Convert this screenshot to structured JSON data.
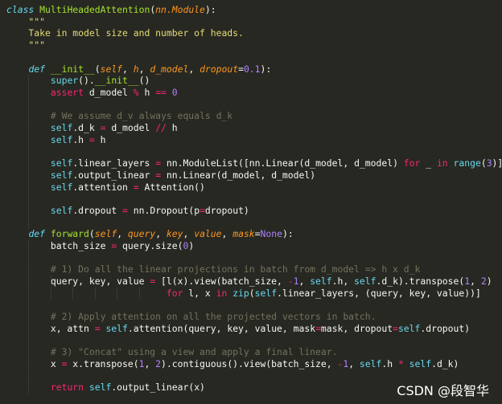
{
  "code_lines": [
    {
      "parts": [
        {
          "t": "class",
          "c": "kw"
        },
        {
          "t": " "
        },
        {
          "t": "MultiHeadedAttention",
          "c": "cls"
        },
        {
          "t": "("
        },
        {
          "t": "nn.Module",
          "c": "param"
        },
        {
          "t": "):"
        }
      ]
    },
    {
      "parts": [
        {
          "t": "    \"\"\"",
          "c": "str"
        }
      ]
    },
    {
      "parts": [
        {
          "t": "    Take in model size and number of heads.",
          "c": "str"
        }
      ]
    },
    {
      "parts": [
        {
          "t": "    \"\"\"",
          "c": "str"
        }
      ]
    },
    {
      "parts": []
    },
    {
      "parts": [
        {
          "t": "    "
        },
        {
          "t": "def",
          "c": "kw"
        },
        {
          "t": " "
        },
        {
          "t": "__init__",
          "c": "fn"
        },
        {
          "t": "("
        },
        {
          "t": "self",
          "c": "param"
        },
        {
          "t": ", "
        },
        {
          "t": "h",
          "c": "param"
        },
        {
          "t": ", "
        },
        {
          "t": "d_model",
          "c": "param"
        },
        {
          "t": ", "
        },
        {
          "t": "dropout",
          "c": "param"
        },
        {
          "t": "="
        },
        {
          "t": "0.1",
          "c": "num"
        },
        {
          "t": "):"
        }
      ]
    },
    {
      "parts": [
        {
          "t": "        "
        },
        {
          "t": "super",
          "c": "bi"
        },
        {
          "t": "()."
        },
        {
          "t": "__init__",
          "c": "fn"
        },
        {
          "t": "()"
        }
      ]
    },
    {
      "parts": [
        {
          "t": "        "
        },
        {
          "t": "assert",
          "c": "kwp"
        },
        {
          "t": " d_model "
        },
        {
          "t": "%",
          "c": "op"
        },
        {
          "t": " h "
        },
        {
          "t": "==",
          "c": "op"
        },
        {
          "t": " "
        },
        {
          "t": "0",
          "c": "num"
        }
      ]
    },
    {
      "parts": []
    },
    {
      "parts": [
        {
          "t": "        # We assume d_v always equals d_k",
          "c": "cmt"
        }
      ]
    },
    {
      "parts": [
        {
          "t": "        "
        },
        {
          "t": "self",
          "c": "self"
        },
        {
          "t": ".d_k "
        },
        {
          "t": "=",
          "c": "op"
        },
        {
          "t": " d_model "
        },
        {
          "t": "//",
          "c": "op"
        },
        {
          "t": " h"
        }
      ]
    },
    {
      "parts": [
        {
          "t": "        "
        },
        {
          "t": "self",
          "c": "self"
        },
        {
          "t": ".h "
        },
        {
          "t": "=",
          "c": "op"
        },
        {
          "t": " h"
        }
      ]
    },
    {
      "parts": []
    },
    {
      "parts": [
        {
          "t": "        "
        },
        {
          "t": "self",
          "c": "self"
        },
        {
          "t": ".linear_layers "
        },
        {
          "t": "=",
          "c": "op"
        },
        {
          "t": " nn.ModuleList([nn.Linear(d_model, d_model) "
        },
        {
          "t": "for",
          "c": "kwp"
        },
        {
          "t": " _ "
        },
        {
          "t": "in",
          "c": "kwp"
        },
        {
          "t": " "
        },
        {
          "t": "range",
          "c": "bi"
        },
        {
          "t": "("
        },
        {
          "t": "3",
          "c": "num"
        },
        {
          "t": ")])"
        }
      ]
    },
    {
      "parts": [
        {
          "t": "        "
        },
        {
          "t": "self",
          "c": "self"
        },
        {
          "t": ".output_linear "
        },
        {
          "t": "=",
          "c": "op"
        },
        {
          "t": " nn.Linear(d_model, d_model)"
        }
      ]
    },
    {
      "parts": [
        {
          "t": "        "
        },
        {
          "t": "self",
          "c": "self"
        },
        {
          "t": ".attention "
        },
        {
          "t": "=",
          "c": "op"
        },
        {
          "t": " Attention()"
        }
      ]
    },
    {
      "parts": []
    },
    {
      "parts": [
        {
          "t": "        "
        },
        {
          "t": "self",
          "c": "self"
        },
        {
          "t": ".dropout "
        },
        {
          "t": "=",
          "c": "op"
        },
        {
          "t": " nn.Dropout(p"
        },
        {
          "t": "=",
          "c": "op"
        },
        {
          "t": "dropout)"
        }
      ]
    },
    {
      "parts": []
    },
    {
      "parts": [
        {
          "t": "    "
        },
        {
          "t": "def",
          "c": "kw"
        },
        {
          "t": " "
        },
        {
          "t": "forward",
          "c": "fn"
        },
        {
          "t": "("
        },
        {
          "t": "self",
          "c": "param"
        },
        {
          "t": ", "
        },
        {
          "t": "query",
          "c": "param"
        },
        {
          "t": ", "
        },
        {
          "t": "key",
          "c": "param"
        },
        {
          "t": ", "
        },
        {
          "t": "value",
          "c": "param"
        },
        {
          "t": ", "
        },
        {
          "t": "mask",
          "c": "param"
        },
        {
          "t": "="
        },
        {
          "t": "None",
          "c": "num"
        },
        {
          "t": "):"
        }
      ]
    },
    {
      "parts": [
        {
          "t": "        batch_size "
        },
        {
          "t": "=",
          "c": "op"
        },
        {
          "t": " query.size("
        },
        {
          "t": "0",
          "c": "num"
        },
        {
          "t": ")"
        }
      ]
    },
    {
      "parts": []
    },
    {
      "parts": [
        {
          "t": "        # 1) Do all the linear projections in batch from d_model => h x d_k",
          "c": "cmt"
        }
      ]
    },
    {
      "parts": [
        {
          "t": "        query, key, value "
        },
        {
          "t": "=",
          "c": "op"
        },
        {
          "t": " [l(x).view(batch_size, "
        },
        {
          "t": "-",
          "c": "op"
        },
        {
          "t": "1",
          "c": "num"
        },
        {
          "t": ", "
        },
        {
          "t": "self",
          "c": "self"
        },
        {
          "t": ".h, "
        },
        {
          "t": "self",
          "c": "self"
        },
        {
          "t": ".d_k).transpose("
        },
        {
          "t": "1",
          "c": "num"
        },
        {
          "t": ", "
        },
        {
          "t": "2",
          "c": "num"
        },
        {
          "t": ")"
        }
      ]
    },
    {
      "parts": [
        {
          "t": "                             "
        },
        {
          "t": "for",
          "c": "kwp"
        },
        {
          "t": " l, x "
        },
        {
          "t": "in",
          "c": "kwp"
        },
        {
          "t": " "
        },
        {
          "t": "zip",
          "c": "bi"
        },
        {
          "t": "("
        },
        {
          "t": "self",
          "c": "self"
        },
        {
          "t": ".linear_layers, (query, key, value))]"
        }
      ]
    },
    {
      "parts": []
    },
    {
      "parts": [
        {
          "t": "        # 2) Apply attention on all the projected vectors in batch.",
          "c": "cmt"
        }
      ]
    },
    {
      "parts": [
        {
          "t": "        x, attn "
        },
        {
          "t": "=",
          "c": "op"
        },
        {
          "t": " "
        },
        {
          "t": "self",
          "c": "self"
        },
        {
          "t": ".attention(query, key, value, mask"
        },
        {
          "t": "=",
          "c": "op"
        },
        {
          "t": "mask, dropout"
        },
        {
          "t": "=",
          "c": "op"
        },
        {
          "t": "self",
          "c": "self"
        },
        {
          "t": ".dropout)"
        }
      ]
    },
    {
      "parts": []
    },
    {
      "parts": [
        {
          "t": "        # 3) \"Concat\" using a view and apply a final linear.",
          "c": "cmt"
        }
      ]
    },
    {
      "parts": [
        {
          "t": "        x "
        },
        {
          "t": "=",
          "c": "op"
        },
        {
          "t": " x.transpose("
        },
        {
          "t": "1",
          "c": "num"
        },
        {
          "t": ", "
        },
        {
          "t": "2",
          "c": "num"
        },
        {
          "t": ").contiguous().view(batch_size, "
        },
        {
          "t": "-",
          "c": "op"
        },
        {
          "t": "1",
          "c": "num"
        },
        {
          "t": ", "
        },
        {
          "t": "self",
          "c": "self"
        },
        {
          "t": ".h "
        },
        {
          "t": "*",
          "c": "op"
        },
        {
          "t": " "
        },
        {
          "t": "self",
          "c": "self"
        },
        {
          "t": ".d_k)"
        }
      ]
    },
    {
      "parts": []
    },
    {
      "parts": [
        {
          "t": "        "
        },
        {
          "t": "return",
          "c": "kwp"
        },
        {
          "t": " "
        },
        {
          "t": "self",
          "c": "self"
        },
        {
          "t": ".output_linear(x)"
        }
      ]
    }
  ],
  "watermark": "CSDN @段智华"
}
